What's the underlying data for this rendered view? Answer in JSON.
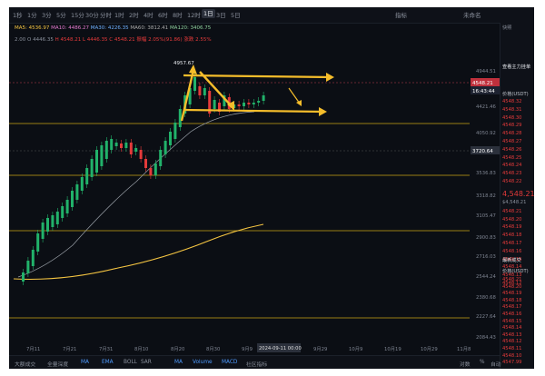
{
  "toolbar": {
    "timeframes": [
      "1秒",
      "1分",
      "3分",
      "5分",
      "15分",
      "30分",
      "分时",
      "1时",
      "2时",
      "4时",
      "6时",
      "8时",
      "12时",
      "1日",
      "3日",
      "5日"
    ],
    "active_timeframe": "1日",
    "indicators_label": "指标",
    "right_label": "未命名"
  },
  "indicator_rows": {
    "row1": [
      "MA5: 4536.97",
      "MA10: 4486.27",
      "MA30: 4226.35",
      "MA60: 3812.41",
      "MA120: 3406.75"
    ],
    "row2": [
      "2.00",
      "O 4446.35",
      "H 4548.21",
      "L 4446.35",
      "C 4548.21",
      "振幅 2.05%(91.86)",
      "涨跌 2.55%"
    ]
  },
  "chart": {
    "peak_label": "4957.67",
    "price_tag": "4548.21",
    "countdown_tag": "16:43:44",
    "line_tag": "3720.64",
    "date_tag": "2024-09-11 00:00",
    "y_ticks": [
      "4944.51",
      "4678.53",
      "4421.46",
      "4050.92",
      "3790.31",
      "3536.83",
      "3318.82",
      "3105.47",
      "2900.83",
      "2716.03",
      "2544.24",
      "2380.68",
      "2227.64",
      "2084.43"
    ],
    "x_ticks": [
      "7月11",
      "7月21",
      "7月31",
      "8月10",
      "8月20",
      "8月30",
      "9月9",
      "9月19",
      "9月29",
      "10月9",
      "10月19",
      "10月29",
      "11月8"
    ]
  },
  "right_panel": {
    "title": "查看主力挂单",
    "subtitle": "快照",
    "header": "价格(USDT)",
    "asks": [
      "4548.32",
      "4548.31",
      "4548.30",
      "4548.29",
      "4548.28",
      "4548.27",
      "4548.26",
      "4548.25",
      "4548.24",
      "4548.23",
      "4548.22"
    ],
    "last_price": "4,548.21",
    "last_sub": "$4,548.21",
    "bids": [
      "4548.21",
      "4548.20",
      "4548.19",
      "4548.18",
      "4548.17",
      "4548.16",
      "4548.15",
      "4548.14",
      "4548.13",
      "4548.12"
    ],
    "trades_title": "最新成交",
    "trades_header": "价格(USDT)",
    "trades": [
      "4548.21",
      "4548.20",
      "4548.19",
      "4548.18",
      "4548.17",
      "4548.16",
      "4548.15",
      "4548.14",
      "4548.13",
      "4548.12",
      "4548.11",
      "4548.10",
      "4547.99"
    ]
  },
  "bottom_bar": {
    "items": [
      "大额成交",
      "全量深度",
      "MA",
      "EMA",
      "BOLL",
      "SAR",
      "MA",
      "Volume",
      "MACD",
      "社区指标",
      "对数",
      "%",
      "自动"
    ]
  },
  "colors": {
    "up": "#21b26a",
    "down": "#e53a3a",
    "level": "#c8a614",
    "arrow": "#f5bd2b",
    "ma": "#f5c542"
  }
}
